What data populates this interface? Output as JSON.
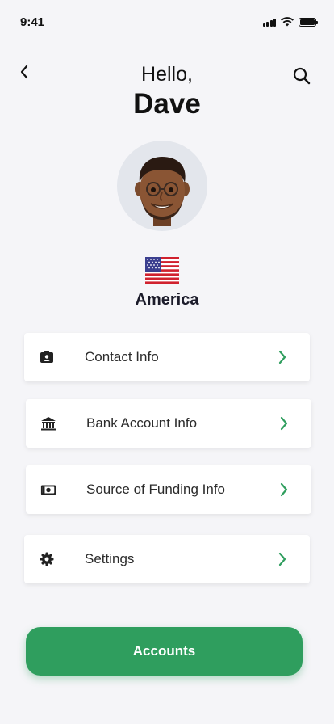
{
  "status_bar": {
    "time": "9:41",
    "icons": [
      "signal-icon",
      "wifi-icon",
      "battery-icon"
    ]
  },
  "header": {
    "greeting": "Hello,",
    "user_name": "Dave",
    "back_icon": "chevron-left-icon",
    "search_icon": "search-icon"
  },
  "profile": {
    "avatar": "memoji-avatar",
    "flag": "us-flag",
    "country": "America"
  },
  "menu": {
    "items": [
      {
        "label": "Contact Info",
        "icon": "contact-card-icon"
      },
      {
        "label": "Bank Account Info",
        "icon": "bank-icon"
      },
      {
        "label": "Source of Funding Info",
        "icon": "cash-icon"
      },
      {
        "label": "Settings",
        "icon": "gear-icon"
      }
    ],
    "chevron_icon": "chevron-right-icon"
  },
  "primary_action": {
    "label": "Accounts"
  },
  "colors": {
    "accent": "#2f9e5e",
    "background": "#f5f5f8",
    "card": "#ffffff",
    "text": "#222222"
  }
}
